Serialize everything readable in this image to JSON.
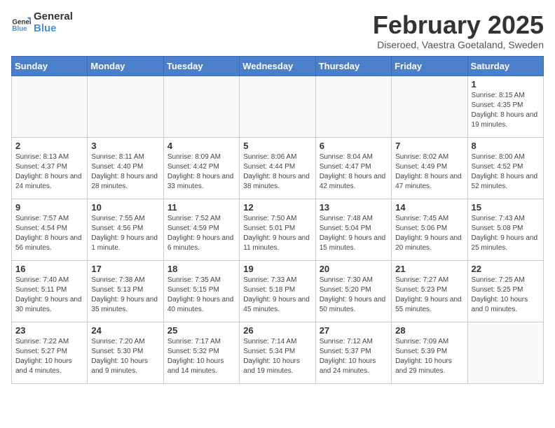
{
  "logo": {
    "text_general": "General",
    "text_blue": "Blue"
  },
  "header": {
    "month_year": "February 2025",
    "location": "Diseroed, Vaestra Goetaland, Sweden"
  },
  "weekdays": [
    "Sunday",
    "Monday",
    "Tuesday",
    "Wednesday",
    "Thursday",
    "Friday",
    "Saturday"
  ],
  "weeks": [
    [
      {
        "day": "",
        "info": ""
      },
      {
        "day": "",
        "info": ""
      },
      {
        "day": "",
        "info": ""
      },
      {
        "day": "",
        "info": ""
      },
      {
        "day": "",
        "info": ""
      },
      {
        "day": "",
        "info": ""
      },
      {
        "day": "1",
        "info": "Sunrise: 8:15 AM\nSunset: 4:35 PM\nDaylight: 8 hours\nand 19 minutes."
      }
    ],
    [
      {
        "day": "2",
        "info": "Sunrise: 8:13 AM\nSunset: 4:37 PM\nDaylight: 8 hours\nand 24 minutes."
      },
      {
        "day": "3",
        "info": "Sunrise: 8:11 AM\nSunset: 4:40 PM\nDaylight: 8 hours\nand 28 minutes."
      },
      {
        "day": "4",
        "info": "Sunrise: 8:09 AM\nSunset: 4:42 PM\nDaylight: 8 hours\nand 33 minutes."
      },
      {
        "day": "5",
        "info": "Sunrise: 8:06 AM\nSunset: 4:44 PM\nDaylight: 8 hours\nand 38 minutes."
      },
      {
        "day": "6",
        "info": "Sunrise: 8:04 AM\nSunset: 4:47 PM\nDaylight: 8 hours\nand 42 minutes."
      },
      {
        "day": "7",
        "info": "Sunrise: 8:02 AM\nSunset: 4:49 PM\nDaylight: 8 hours\nand 47 minutes."
      },
      {
        "day": "8",
        "info": "Sunrise: 8:00 AM\nSunset: 4:52 PM\nDaylight: 8 hours\nand 52 minutes."
      }
    ],
    [
      {
        "day": "9",
        "info": "Sunrise: 7:57 AM\nSunset: 4:54 PM\nDaylight: 8 hours\nand 56 minutes."
      },
      {
        "day": "10",
        "info": "Sunrise: 7:55 AM\nSunset: 4:56 PM\nDaylight: 9 hours\nand 1 minute."
      },
      {
        "day": "11",
        "info": "Sunrise: 7:52 AM\nSunset: 4:59 PM\nDaylight: 9 hours\nand 6 minutes."
      },
      {
        "day": "12",
        "info": "Sunrise: 7:50 AM\nSunset: 5:01 PM\nDaylight: 9 hours\nand 11 minutes."
      },
      {
        "day": "13",
        "info": "Sunrise: 7:48 AM\nSunset: 5:04 PM\nDaylight: 9 hours\nand 15 minutes."
      },
      {
        "day": "14",
        "info": "Sunrise: 7:45 AM\nSunset: 5:06 PM\nDaylight: 9 hours\nand 20 minutes."
      },
      {
        "day": "15",
        "info": "Sunrise: 7:43 AM\nSunset: 5:08 PM\nDaylight: 9 hours\nand 25 minutes."
      }
    ],
    [
      {
        "day": "16",
        "info": "Sunrise: 7:40 AM\nSunset: 5:11 PM\nDaylight: 9 hours\nand 30 minutes."
      },
      {
        "day": "17",
        "info": "Sunrise: 7:38 AM\nSunset: 5:13 PM\nDaylight: 9 hours\nand 35 minutes."
      },
      {
        "day": "18",
        "info": "Sunrise: 7:35 AM\nSunset: 5:15 PM\nDaylight: 9 hours\nand 40 minutes."
      },
      {
        "day": "19",
        "info": "Sunrise: 7:33 AM\nSunset: 5:18 PM\nDaylight: 9 hours\nand 45 minutes."
      },
      {
        "day": "20",
        "info": "Sunrise: 7:30 AM\nSunset: 5:20 PM\nDaylight: 9 hours\nand 50 minutes."
      },
      {
        "day": "21",
        "info": "Sunrise: 7:27 AM\nSunset: 5:23 PM\nDaylight: 9 hours\nand 55 minutes."
      },
      {
        "day": "22",
        "info": "Sunrise: 7:25 AM\nSunset: 5:25 PM\nDaylight: 10 hours\nand 0 minutes."
      }
    ],
    [
      {
        "day": "23",
        "info": "Sunrise: 7:22 AM\nSunset: 5:27 PM\nDaylight: 10 hours\nand 4 minutes."
      },
      {
        "day": "24",
        "info": "Sunrise: 7:20 AM\nSunset: 5:30 PM\nDaylight: 10 hours\nand 9 minutes."
      },
      {
        "day": "25",
        "info": "Sunrise: 7:17 AM\nSunset: 5:32 PM\nDaylight: 10 hours\nand 14 minutes."
      },
      {
        "day": "26",
        "info": "Sunrise: 7:14 AM\nSunset: 5:34 PM\nDaylight: 10 hours\nand 19 minutes."
      },
      {
        "day": "27",
        "info": "Sunrise: 7:12 AM\nSunset: 5:37 PM\nDaylight: 10 hours\nand 24 minutes."
      },
      {
        "day": "28",
        "info": "Sunrise: 7:09 AM\nSunset: 5:39 PM\nDaylight: 10 hours\nand 29 minutes."
      },
      {
        "day": "",
        "info": ""
      }
    ]
  ]
}
